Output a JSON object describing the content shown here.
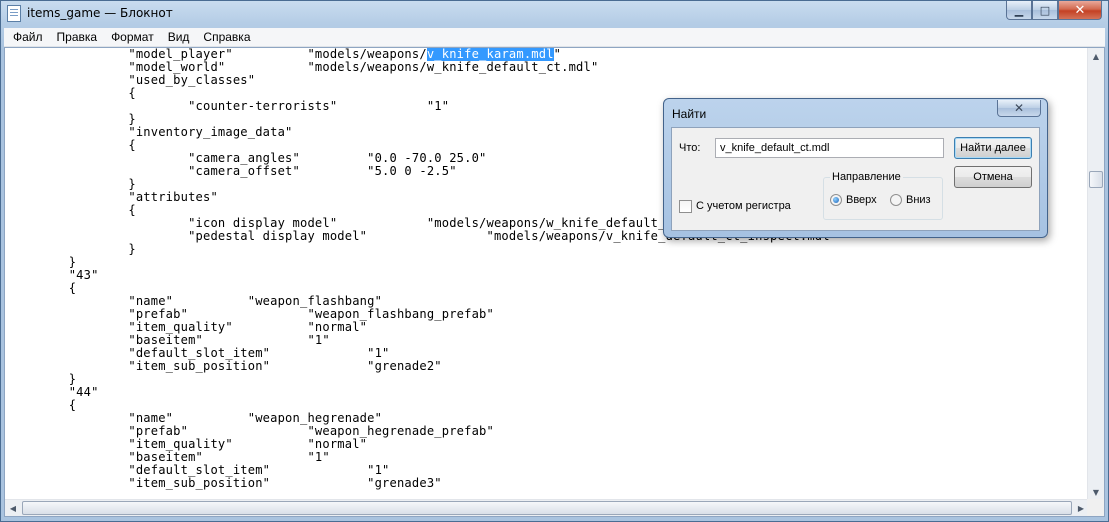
{
  "window": {
    "title": "items_game — Блокнот",
    "minimize_glyph": "▁",
    "maximize_glyph": "□",
    "close_glyph": "✕"
  },
  "menu": [
    "Файл",
    "Правка",
    "Формат",
    "Вид",
    "Справка"
  ],
  "editor": {
    "lines": [
      {
        "text": "                \"model_player\"          \"models/weapons/",
        "hl": "v_knife_karam.mdl",
        "after": "\""
      },
      {
        "text": "                \"model_world\"           \"models/weapons/w_knife_default_ct.mdl\""
      },
      {
        "text": "                \"used_by_classes\""
      },
      {
        "text": "                {"
      },
      {
        "text": "                        \"counter-terrorists\"            \"1\""
      },
      {
        "text": "                }"
      },
      {
        "text": "                \"inventory_image_data\""
      },
      {
        "text": "                {"
      },
      {
        "text": "                        \"camera_angles\"         \"0.0 -70.0 25.0\""
      },
      {
        "text": "                        \"camera_offset\"         \"5.0 0 -2.5\""
      },
      {
        "text": "                }"
      },
      {
        "text": "                \"attributes\""
      },
      {
        "text": "                {"
      },
      {
        "text": "                        \"icon display model\"            \"models/weapons/w_knife_default_ct.mdl\""
      },
      {
        "text": "                        \"pedestal display model\"                \"models/weapons/v_knife_default_ct_inspect.mdl\""
      },
      {
        "text": "                }"
      },
      {
        "text": "        }"
      },
      {
        "text": "        \"43\""
      },
      {
        "text": "        {"
      },
      {
        "text": "                \"name\"          \"weapon_flashbang\""
      },
      {
        "text": "                \"prefab\"                \"weapon_flashbang_prefab\""
      },
      {
        "text": "                \"item_quality\"          \"normal\""
      },
      {
        "text": "                \"baseitem\"              \"1\""
      },
      {
        "text": "                \"default_slot_item\"             \"1\""
      },
      {
        "text": "                \"item_sub_position\"             \"grenade2\""
      },
      {
        "text": "        }"
      },
      {
        "text": "        \"44\""
      },
      {
        "text": "        {"
      },
      {
        "text": "                \"name\"          \"weapon_hegrenade\""
      },
      {
        "text": "                \"prefab\"                \"weapon_hegrenade_prefab\""
      },
      {
        "text": "                \"item_quality\"          \"normal\""
      },
      {
        "text": "                \"baseitem\"              \"1\""
      },
      {
        "text": "                \"default_slot_item\"             \"1\""
      },
      {
        "text": "                \"item_sub_position\"             \"grenade3\""
      }
    ]
  },
  "find_dialog": {
    "title": "Найти",
    "close_glyph": "✕",
    "what_label": "Что:",
    "search_value": "v_knife_default_ct.mdl",
    "find_next_label": "Найти далее",
    "cancel_label": "Отмена",
    "match_case_label": "С учетом регистра",
    "direction_label": "Направление",
    "up_label": "Вверх",
    "down_label": "Вниз",
    "direction_selected": "up"
  },
  "colors": {
    "selection": "#3399ff",
    "title_gradient": "#b5cde6"
  }
}
